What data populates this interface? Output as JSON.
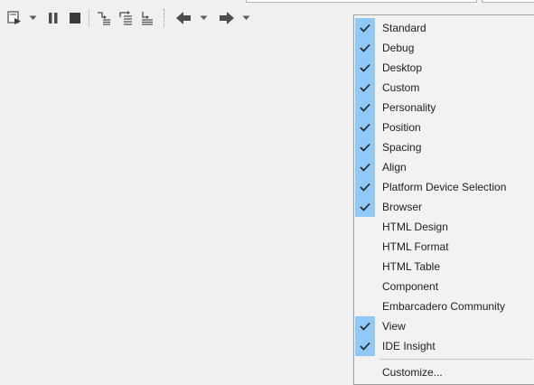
{
  "toolbar": {
    "buttons": [
      {
        "name": "run-without-debugging-button",
        "icon": "run-icon"
      },
      {
        "name": "run-dropdown-button",
        "icon": "chevron-down-icon"
      },
      {
        "name": "pause-button",
        "icon": "pause-icon"
      },
      {
        "name": "stop-button",
        "icon": "stop-icon"
      },
      {
        "name": "trace-into-button",
        "icon": "trace-into-icon"
      },
      {
        "name": "step-over-button",
        "icon": "step-over-icon"
      },
      {
        "name": "run-to-return-button",
        "icon": "run-to-return-icon"
      },
      {
        "name": "back-button",
        "icon": "arrow-left-icon"
      },
      {
        "name": "back-dropdown-button",
        "icon": "chevron-down-icon"
      },
      {
        "name": "forward-button",
        "icon": "arrow-right-icon"
      },
      {
        "name": "forward-dropdown-button",
        "icon": "chevron-down-icon"
      }
    ]
  },
  "menu": {
    "items": [
      {
        "label": "Standard",
        "checked": true
      },
      {
        "label": "Debug",
        "checked": true
      },
      {
        "label": "Desktop",
        "checked": true
      },
      {
        "label": "Custom",
        "checked": true
      },
      {
        "label": "Personality",
        "checked": true
      },
      {
        "label": "Position",
        "checked": true
      },
      {
        "label": "Spacing",
        "checked": true
      },
      {
        "label": "Align",
        "checked": true
      },
      {
        "label": "Platform Device Selection",
        "checked": true
      },
      {
        "label": "Browser",
        "checked": true
      },
      {
        "label": "HTML Design",
        "checked": false
      },
      {
        "label": "HTML Format",
        "checked": false
      },
      {
        "label": "HTML Table",
        "checked": false
      },
      {
        "label": "Component",
        "checked": false
      },
      {
        "label": "Embarcadero Community",
        "checked": false
      },
      {
        "label": "View",
        "checked": true
      },
      {
        "label": "IDE Insight",
        "checked": true
      }
    ],
    "customize_label": "Customize..."
  },
  "colors": {
    "check_highlight": "#90c8f6",
    "menu_background": "#f2f2f2",
    "toolbar_background": "#f0f0f0"
  }
}
